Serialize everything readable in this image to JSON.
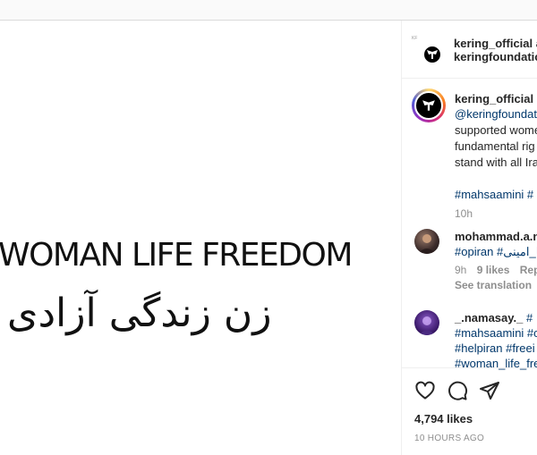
{
  "post_image": {
    "line1": "WOMAN LIFE FREEDOM",
    "line2": "زن زندگی آزادی"
  },
  "post_header": {
    "author": "kering_official a",
    "collaborator": "keringfoundatio"
  },
  "caption": {
    "username": "kering_official",
    "lines": [
      "@keringfoundat",
      "supported wome",
      "fundamental rig",
      "stand with all Ira"
    ],
    "hashtags": "#mahsaamini #",
    "time": "10h"
  },
  "comments": [
    {
      "username": "mohammad.a.n",
      "text": "#opiran #مهسا_امینی",
      "time": "9h",
      "likes": "9 likes",
      "reply": "Repl",
      "see_translation": "See translation"
    },
    {
      "username": "_.namasay._",
      "text_inline": "#",
      "lines": [
        "#mahsaamini #c",
        "#helpiran #freei",
        "#woman_life_fre"
      ]
    }
  ],
  "likes": "4,794 likes",
  "time_ago": "10 HOURS AGO",
  "colors": {
    "link": "#00376b",
    "secondary": "#8e8e8e",
    "divider": "#efefef"
  }
}
